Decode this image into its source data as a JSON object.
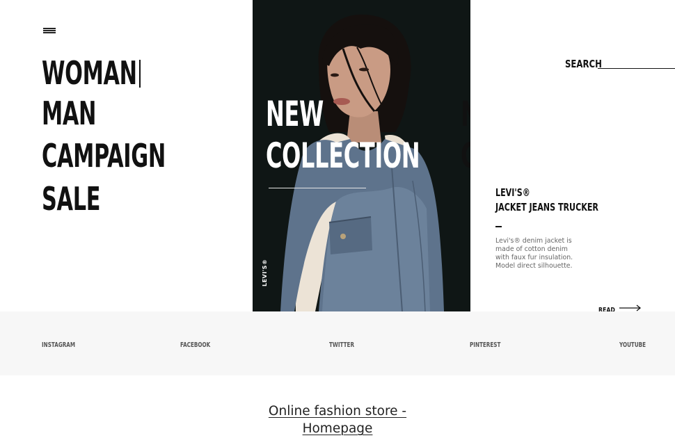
{
  "nav": {
    "menu_icon": "hamburger-icon",
    "items": [
      {
        "label": "WOMAN"
      },
      {
        "label": "MAN"
      },
      {
        "label": "CAMPAIGN"
      },
      {
        "label": "SALE"
      }
    ]
  },
  "hero": {
    "title_line1": "NEW",
    "title_line2": "COLLECTION",
    "brand_vertical": "LEVI'S®",
    "ghost_line1": "N",
    "ghost_line2": "C"
  },
  "search": {
    "label": "SEARCH",
    "value": ""
  },
  "product": {
    "brand": "LEVI'S®",
    "name": "JACKET JEANS TRUCKER",
    "description": "Levi's® denim jacket is made of cotton denim with faux fur insulation. Model direct silhouette.",
    "read_label": "READ",
    "read_icon": "arrow-right-icon"
  },
  "social": {
    "instagram": "INSTAGRAM",
    "facebook": "FACEBOOK",
    "twitter": "TWITTER",
    "pinterest": "PINTEREST",
    "youtube": "YOUTUBE"
  },
  "caption": "Online fashion store - Homepage",
  "colors": {
    "text": "#111111",
    "hero_background": "#0f1615",
    "social_bar": "#f7f7f7",
    "denim": "#5e738c"
  }
}
